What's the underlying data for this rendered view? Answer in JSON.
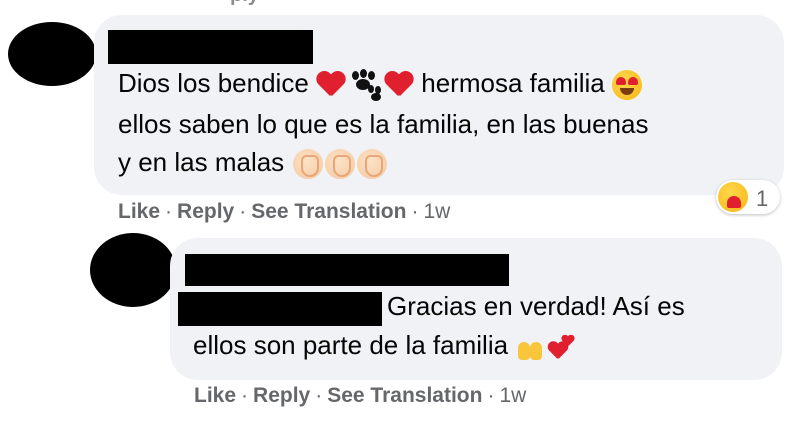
{
  "top_sliver": {
    "text": "ply"
  },
  "comment": {
    "lines": [
      "Dios los bendice",
      "hermosa familia",
      "ellos saben lo que es la familia, en las buenas",
      "y en las malas"
    ],
    "icons": [
      "red-heart-icon",
      "paw-prints-icon",
      "red-heart-icon",
      "heart-eyes-face-icon",
      "clapping-hands-icon",
      "clapping-hands-icon",
      "clapping-hands-icon"
    ],
    "reaction": {
      "icon": "care-face-icon",
      "count": "1"
    },
    "actions": {
      "like": "Like",
      "reply": "Reply",
      "translate": "See Translation",
      "time": "1w"
    }
  },
  "reply": {
    "lines": [
      "Gracias en verdad! Así es",
      "ellos son parte de la familia"
    ],
    "icons": [
      "raised-hands-icon",
      "sparkling-hearts-icon"
    ],
    "actions": {
      "like": "Like",
      "reply": "Reply",
      "translate": "See Translation",
      "time": "1w"
    }
  },
  "colors": {
    "bubble": "#f0f2f5",
    "meta_text": "#65676b",
    "body_text": "#050505",
    "heart": "#e0202f"
  }
}
